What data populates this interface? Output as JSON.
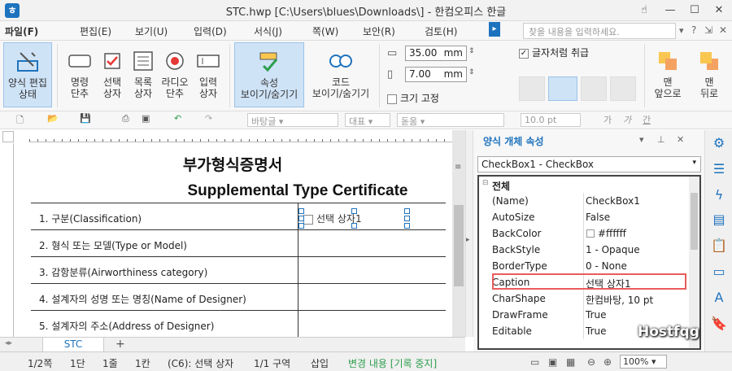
{
  "window": {
    "title": "STC.hwp [C:\\Users\\blues\\Downloads\\] - 한컴오피스 한글",
    "min": "—",
    "max": "☐",
    "close": "✕"
  },
  "menu": [
    "파일(F)",
    "편집(E)",
    "보기(U)",
    "입력(D)",
    "서식(J)",
    "쪽(W)",
    "보안(R)",
    "검토(H)"
  ],
  "search_placeholder": "찾을 내용을 입력하세요.",
  "ribbon": {
    "buttons": [
      {
        "l1": "양식 편집",
        "l2": "상태"
      },
      {
        "l1": "명령",
        "l2": "단추"
      },
      {
        "l1": "선택",
        "l2": "상자"
      },
      {
        "l1": "목록",
        "l2": "상자"
      },
      {
        "l1": "라디오",
        "l2": "단추"
      },
      {
        "l1": "입력",
        "l2": "상자"
      },
      {
        "l1": "속성",
        "l2": "보이기/숨기기"
      },
      {
        "l1": "코드",
        "l2": "보이기/숨기기"
      }
    ],
    "width_value": "35.00",
    "height_value": "7.00",
    "unit": "mm",
    "treat_as_char": "글자처럼 취급",
    "size_fixed": "크기 고정",
    "front": {
      "l1": "맨",
      "l2": "앞으로"
    },
    "back": {
      "l1": "맨",
      "l2": "뒤로"
    }
  },
  "toolbar2": {
    "style": "바탕글",
    "font_kind": "대표",
    "font": "돋움",
    "size": "10.0",
    "size_unit": "pt"
  },
  "document": {
    "title_ko": "부가형식증명서",
    "title_en": "Supplemental Type Certificate",
    "rows": [
      "1. 구분(Classification)",
      "2. 형식 또는 모델(Type or Model)",
      "3. 감항분류(Airworthiness category)",
      "4. 설계자의 성명 또는 명칭(Name of Designer)",
      "5. 설계자의 주소(Address of Designer)"
    ],
    "checkbox_caption": "선택 상자1"
  },
  "tab": "STC",
  "status": {
    "page": "1/2쪽",
    "col": "1단",
    "line": "1줄",
    "char": "1칸",
    "cell": "(C6): 선택 상자",
    "section": "1/1 구역",
    "mode": "삽입",
    "track": "변경 내용 [기록 중지]",
    "zoom": "100%"
  },
  "panel": {
    "title": "양식 개체 속성",
    "selected": "CheckBox1 - CheckBox",
    "group": "전체",
    "props": [
      {
        "name": "(Name)",
        "value": "CheckBox1"
      },
      {
        "name": "AutoSize",
        "value": "False"
      },
      {
        "name": "BackColor",
        "value": "#ffffff"
      },
      {
        "name": "BackStyle",
        "value": "1 - Opaque"
      },
      {
        "name": "BorderType",
        "value": "0 - None"
      },
      {
        "name": "Caption",
        "value": "선택 상자1"
      },
      {
        "name": "CharShape",
        "value": "한컴바탕, 10 pt"
      },
      {
        "name": "DrawFrame",
        "value": "True"
      },
      {
        "name": "Editable",
        "value": "True"
      }
    ]
  },
  "watermark": "Hostfqg"
}
